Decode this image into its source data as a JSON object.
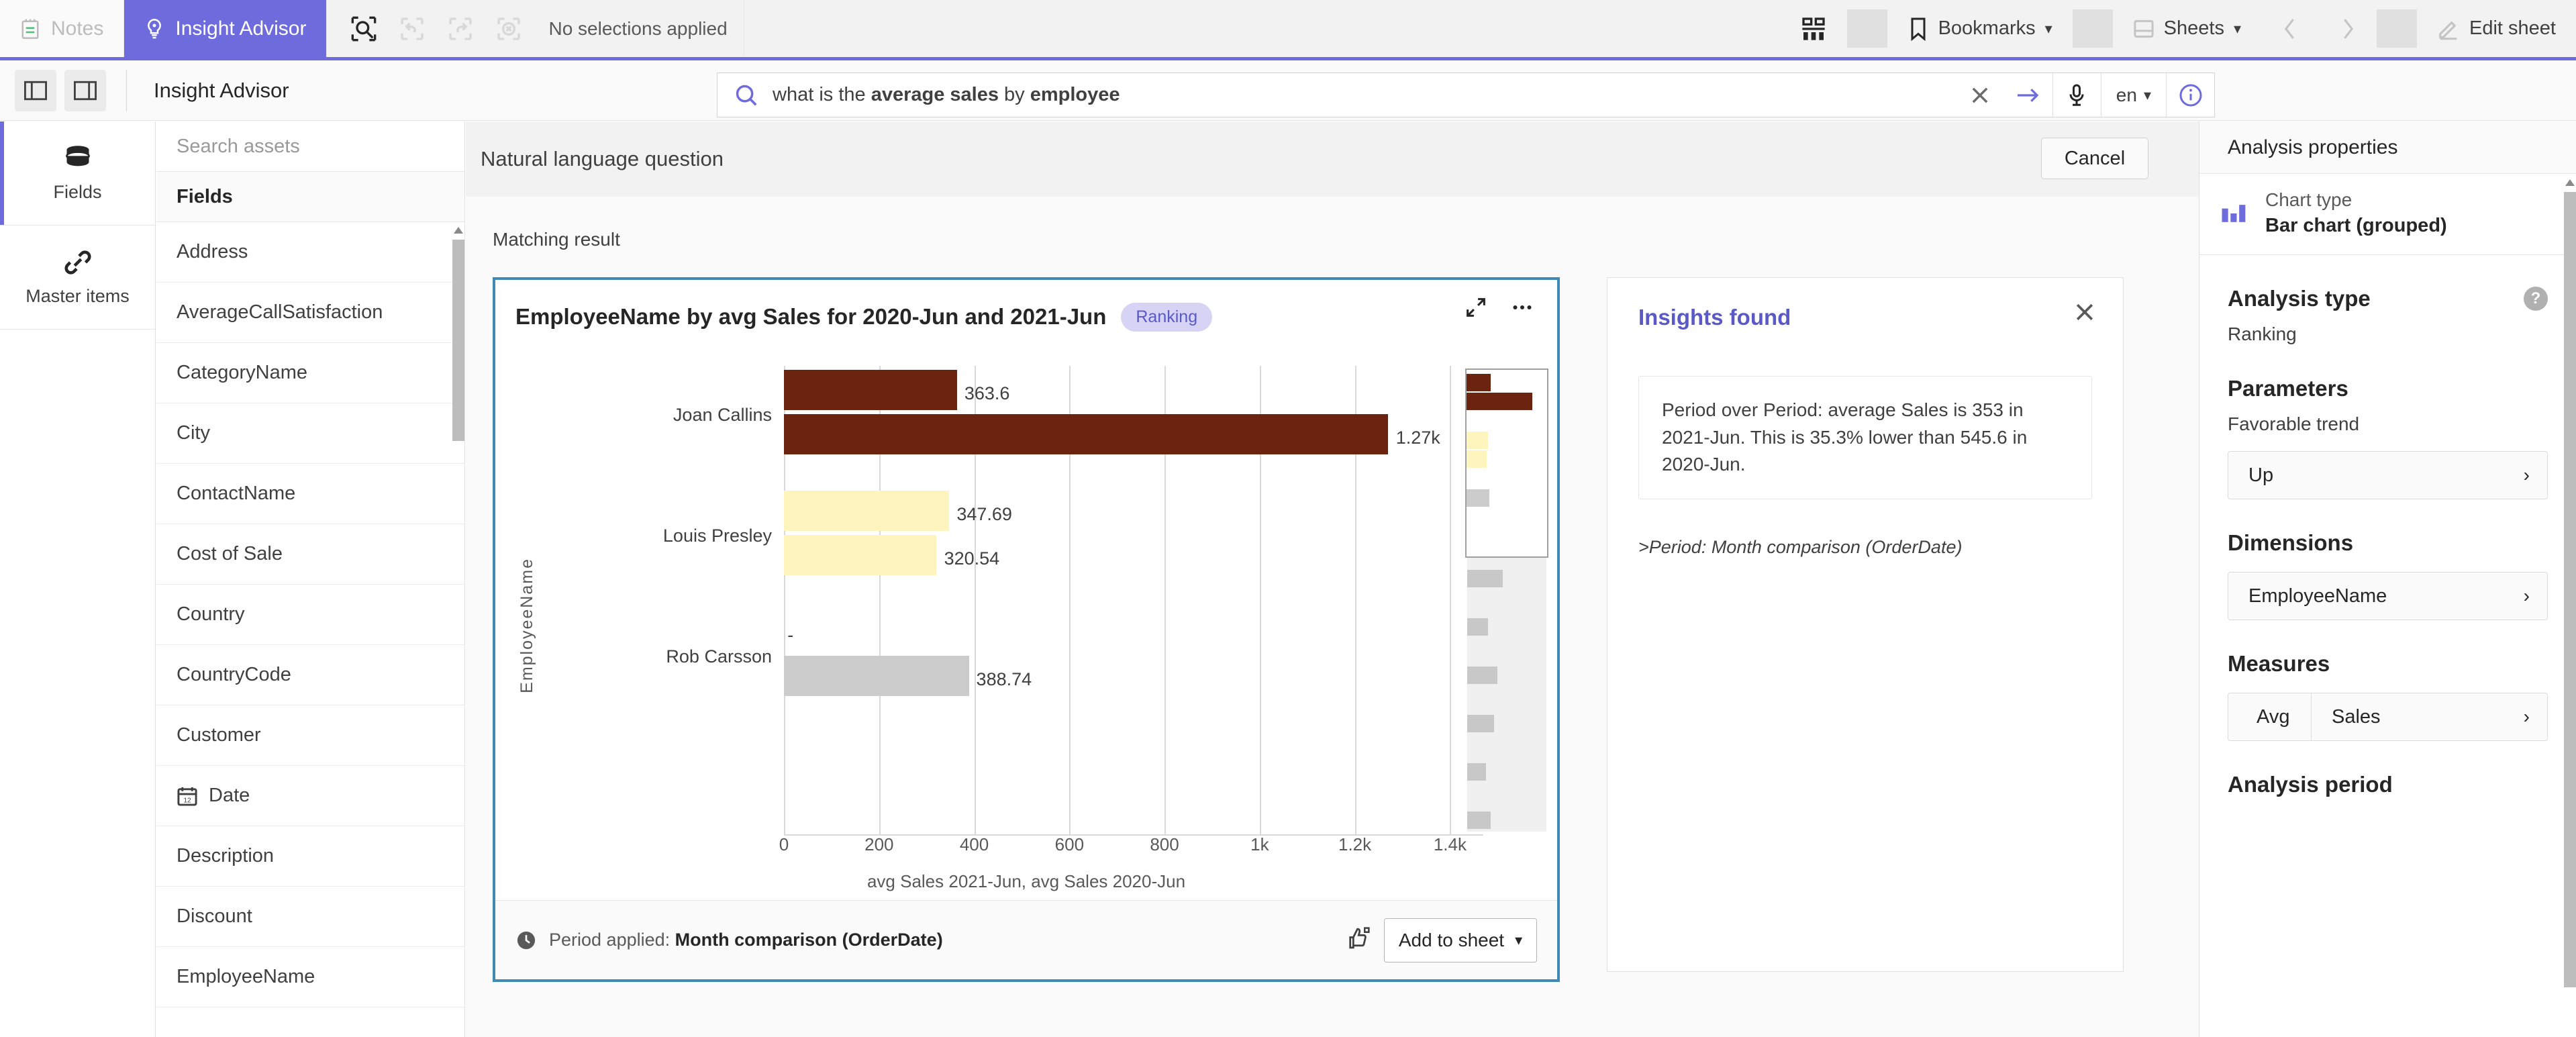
{
  "topnav": {
    "notes_label": "Notes",
    "insight_advisor_label": "Insight Advisor",
    "selections_text": "No selections applied",
    "bookmarks_label": "Bookmarks",
    "sheets_label": "Sheets",
    "edit_sheet_label": "Edit sheet"
  },
  "subheader": {
    "title": "Insight Advisor",
    "search": {
      "value_plain": "what is the average sales by employee",
      "part1": "what is the ",
      "bold1": "average sales",
      "part2": " by ",
      "bold2": "employee",
      "language": "en"
    }
  },
  "rail": {
    "items": [
      {
        "label": "Fields",
        "icon": "database-icon"
      },
      {
        "label": "Master items",
        "icon": "link-icon"
      }
    ]
  },
  "assets": {
    "search_placeholder": "Search assets",
    "header": "Fields",
    "fields": [
      {
        "label": "Address",
        "icon": ""
      },
      {
        "label": "AverageCallSatisfaction",
        "icon": ""
      },
      {
        "label": "CategoryName",
        "icon": ""
      },
      {
        "label": "City",
        "icon": ""
      },
      {
        "label": "ContactName",
        "icon": ""
      },
      {
        "label": "Cost of Sale",
        "icon": ""
      },
      {
        "label": "Country",
        "icon": ""
      },
      {
        "label": "CountryCode",
        "icon": ""
      },
      {
        "label": "Customer",
        "icon": ""
      },
      {
        "label": "Date",
        "icon": "calendar-icon"
      },
      {
        "label": "Description",
        "icon": ""
      },
      {
        "label": "Discount",
        "icon": ""
      },
      {
        "label": "EmployeeName",
        "icon": ""
      }
    ]
  },
  "center": {
    "nlq_title": "Natural language question",
    "cancel_label": "Cancel",
    "matching_result_label": "Matching result"
  },
  "card": {
    "title": "EmployeeName by avg Sales for 2020-Jun and 2021-Jun",
    "badge": "Ranking",
    "footer_prefix": "Period applied:",
    "footer_value": "Month comparison (OrderDate)",
    "add_to_sheet_label": "Add to sheet"
  },
  "insights": {
    "title": "Insights found",
    "body": "Period over Period: average Sales is 353 in 2021-Jun. This is 35.3% lower than 545.6 in 2020-Jun.",
    "sub": ">Period: Month comparison (OrderDate)"
  },
  "props": {
    "header": "Analysis properties",
    "chart_type_label": "Chart type",
    "chart_type_value": "Bar chart (grouped)",
    "analysis_type_title": "Analysis type",
    "analysis_type_value": "Ranking",
    "parameters_title": "Parameters",
    "favorable_trend_label": "Favorable trend",
    "favorable_trend_value": "Up",
    "dimensions_title": "Dimensions",
    "dimension_value": "EmployeeName",
    "measures_title": "Measures",
    "measure_agg": "Avg",
    "measure_field": "Sales",
    "analysis_period_title": "Analysis period"
  },
  "colors": {
    "brand_purple": "#6e6bdd",
    "card_border_blue": "#3f8ab4",
    "series_2021": "#FEF5BE",
    "series_2020": "#6B2410",
    "series_neutral": "#CCCCCC"
  },
  "chart_data": {
    "type": "bar",
    "orientation": "horizontal",
    "title": "EmployeeName by avg Sales for 2020-Jun and 2021-Jun",
    "xlabel": "avg Sales 2021-Jun, avg Sales 2020-Jun",
    "ylabel": "EmployeeName",
    "categories": [
      "Joan Callins",
      "Louis Presley",
      "Rob Carsson"
    ],
    "series": [
      {
        "name": "avg Sales 2021-Jun",
        "values": [
          363.6,
          347.69,
          null
        ]
      },
      {
        "name": "avg Sales 2020-Jun",
        "values": [
          1270,
          320.54,
          388.74
        ]
      }
    ],
    "bars": [
      {
        "category": "Joan Callins",
        "series": "avg Sales 2021-Jun",
        "value": 363.6,
        "label": "363.6",
        "color": "#6B2410"
      },
      {
        "category": "Joan Callins",
        "series": "avg Sales 2020-Jun",
        "value": 1270,
        "label": "1.27k",
        "color": "#6B2410"
      },
      {
        "category": "Louis Presley",
        "series": "avg Sales 2021-Jun",
        "value": 347.69,
        "label": "347.69",
        "color": "#FEF5BE"
      },
      {
        "category": "Louis Presley",
        "series": "avg Sales 2020-Jun",
        "value": 320.54,
        "label": "320.54",
        "color": "#FEF5BE"
      },
      {
        "category": "Rob Carsson",
        "series": "avg Sales 2021-Jun",
        "value": 0,
        "label": "-",
        "color": "#CCCCCC"
      },
      {
        "category": "Rob Carsson",
        "series": "avg Sales 2020-Jun",
        "value": 388.74,
        "label": "388.74",
        "color": "#CCCCCC"
      }
    ],
    "xlim": [
      0,
      1470
    ],
    "xticks": [
      0,
      200,
      400,
      600,
      800,
      1000,
      1200,
      1400
    ],
    "xticklabels": [
      "0",
      "200",
      "400",
      "600",
      "800",
      "1k",
      "1.2k",
      "1.4k"
    ],
    "grid": true,
    "legend": false
  }
}
